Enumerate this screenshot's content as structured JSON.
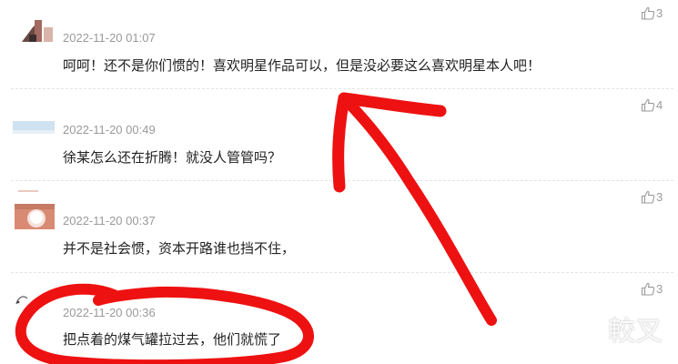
{
  "comments": [
    {
      "timestamp": "2022-11-20 01:07",
      "text": "呵呵！还不是你们惯的！喜欢明星作品可以，但是没必要这么喜欢明星本人吧！",
      "likes": "3"
    },
    {
      "timestamp": "2022-11-20 00:49",
      "text": "徐某怎么还在折腾！就没人管管吗？",
      "likes": "4"
    },
    {
      "timestamp": "2022-11-20 00:37",
      "text": "并不是社会惯，资本开路谁也挡不住，",
      "likes": "3"
    },
    {
      "timestamp": "2022-11-20 00:36",
      "text": "把点着的煤气罐拉过去，他们就慌了",
      "likes": "3"
    }
  ],
  "watermark": "較叉",
  "annotation_color": "#ee1111",
  "icons": {
    "like": "thumbs-up-icon",
    "avatar": "avatar"
  }
}
